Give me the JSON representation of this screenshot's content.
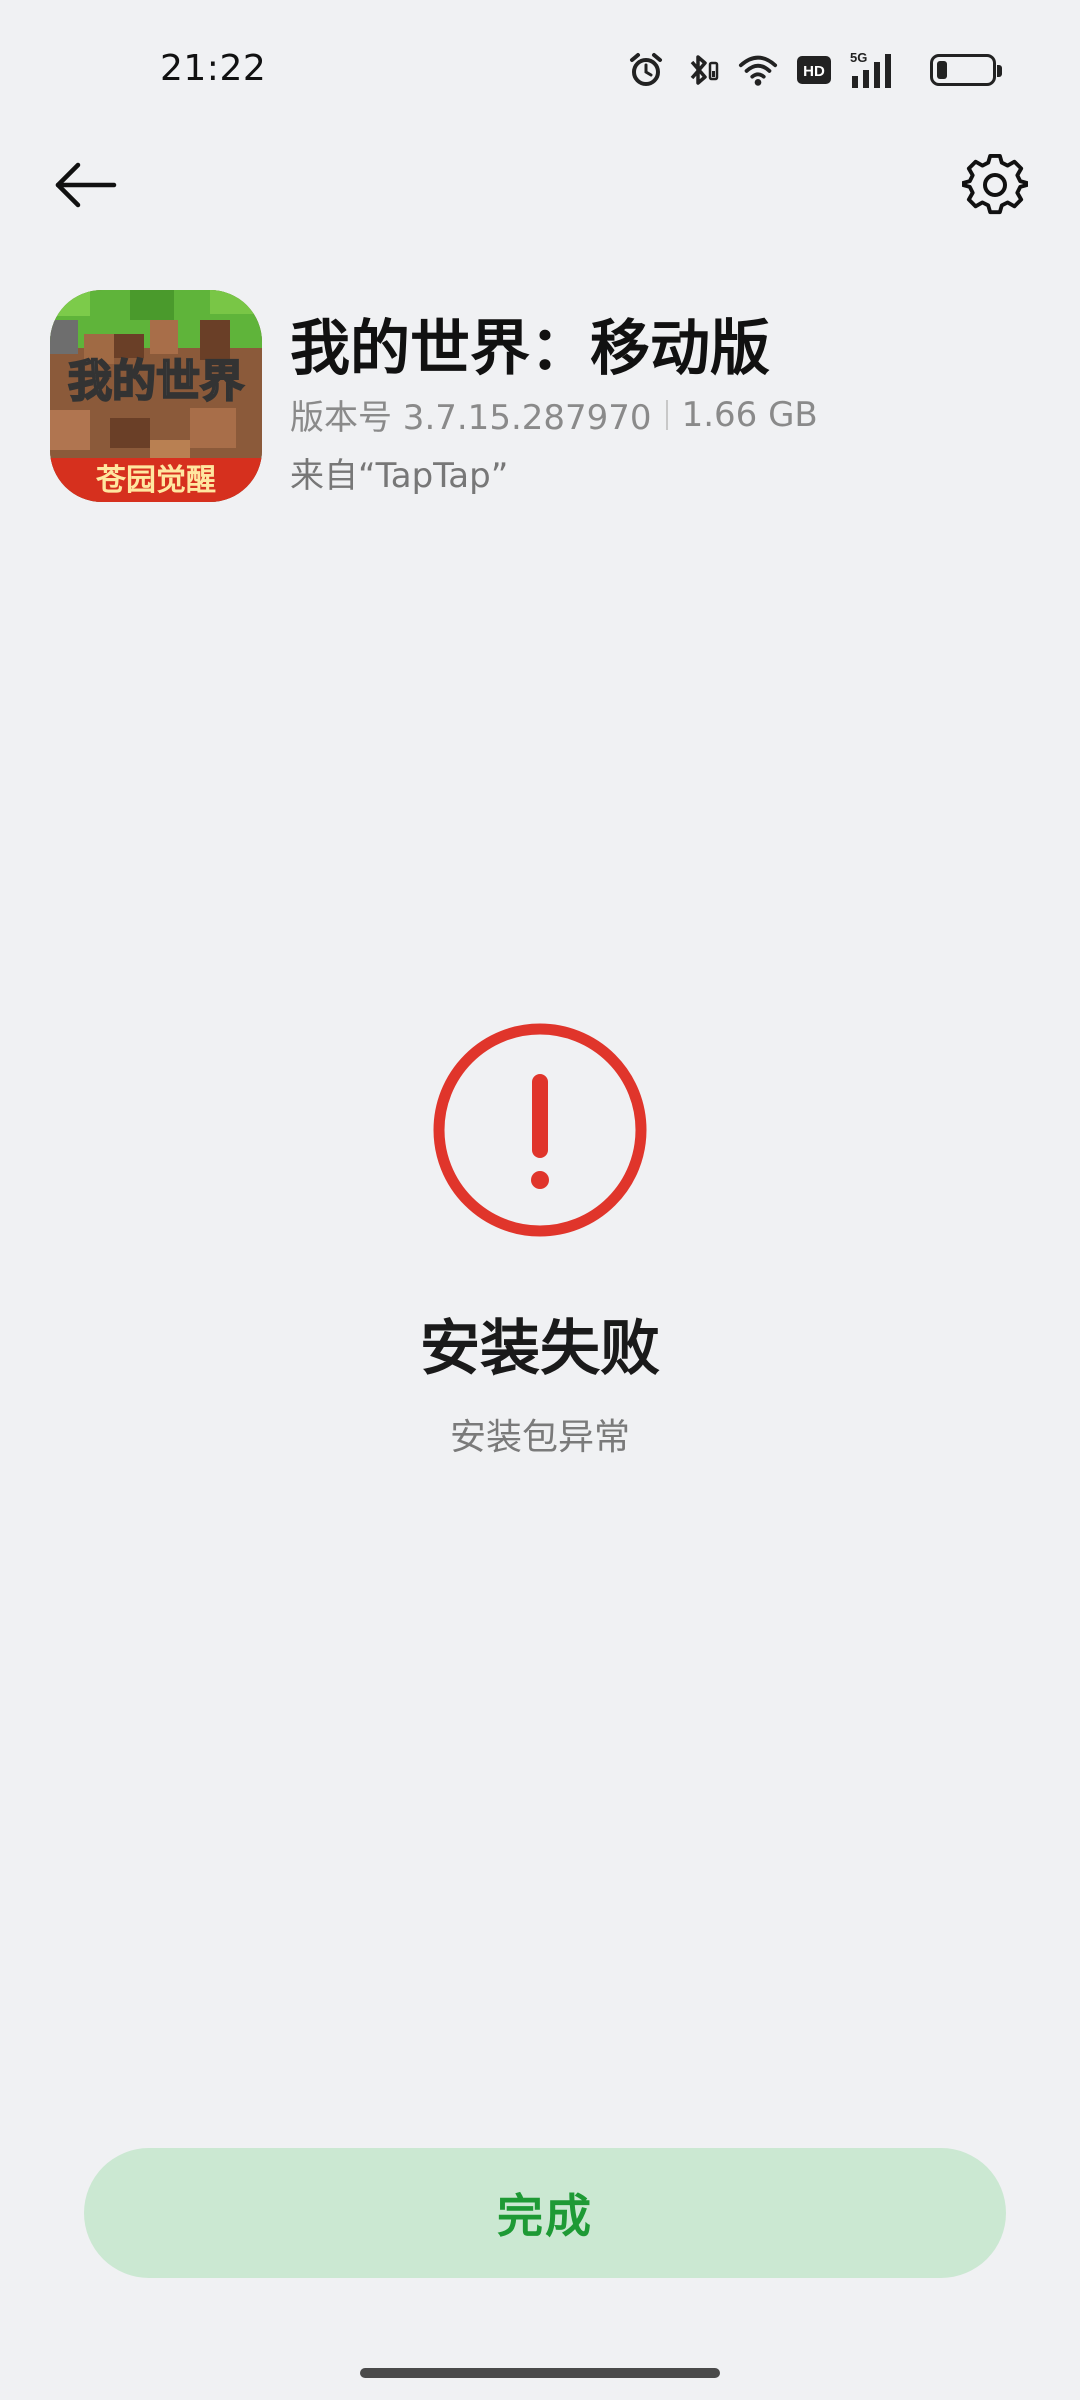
{
  "status_bar": {
    "time": "21:22",
    "icons": [
      "alarm-icon",
      "bluetooth-icon",
      "wifi-icon",
      "hd-icon",
      "signal-5g-icon",
      "battery-icon"
    ],
    "hd_label": "HD",
    "network_label": "5G",
    "battery_level": 0.2
  },
  "app_bar": {
    "back_icon": "arrow-left-icon",
    "settings_icon": "gear-icon"
  },
  "app": {
    "name": "我的世界：移动版",
    "version_label": "版本号 3.7.15.287970",
    "size": "1.66 GB",
    "source": "来自“TapTap”",
    "icon_text_top": "我的世界",
    "icon_text_bottom": "苍园觉醒"
  },
  "result": {
    "icon": "error-exclamation-icon",
    "title": "安装失败",
    "reason": "安装包异常"
  },
  "actions": {
    "done_label": "完成"
  },
  "colors": {
    "background": "#f0f1f3",
    "error_red": "#e0352b",
    "button_bg": "#cbe8d2",
    "button_text": "#1e9a35"
  }
}
